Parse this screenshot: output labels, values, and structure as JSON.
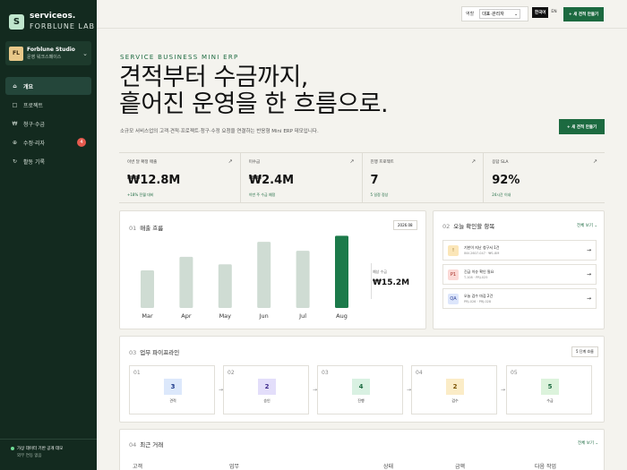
{
  "sidebar": {
    "brand_logo": "S",
    "brand_name": "serviceos.",
    "brand_sub": "FORBLUNE LAB",
    "workspace": {
      "initials": "FL",
      "name": "Forblune Studio",
      "sub": "운영 워크스페이스"
    },
    "items": [
      {
        "icon": "⌂",
        "label": "개요",
        "active": true
      },
      {
        "icon": "□",
        "label": "프로젝트",
        "active": false
      },
      {
        "icon": "₩",
        "label": "청구·수금",
        "active": false
      },
      {
        "icon": "⊕",
        "label": "수정·리자",
        "active": false,
        "badge": "4"
      },
      {
        "icon": "↻",
        "label": "활동 기록",
        "active": false
      }
    ],
    "footer_status": "가상 데이터 기반 공개 데모",
    "footer_sub": "외부 연동 없음"
  },
  "topbar": {
    "role_label": "역할",
    "role_value": "대표·관리자",
    "lang_ko": "한국어",
    "lang_en": "EN",
    "new_button": "+ 새 견적 만들기"
  },
  "hero": {
    "eyebrow": "SERVICE BUSINESS MINI ERP",
    "title_line1": "견적부터 수금까지,",
    "title_line2": "흩어진 운영을 한 흐름으로.",
    "description": "소규모 서비스업의 고객·견적·프로젝트·청구·수정 요청을 연결하는 반응형 Mini ERP 데모입니다.",
    "new_button": "+ 새 견적 만들기"
  },
  "kpis": [
    {
      "label": "이번 달 확정 매출",
      "value": "₩12.8M",
      "note": "+18% 전월 대비"
    },
    {
      "label": "미수금",
      "value": "₩2.4M",
      "note": "이번 주 수금 예정"
    },
    {
      "label": "진행 프로젝트",
      "value": "7",
      "note": "5 일정 정상"
    },
    {
      "label": "응답 SLA",
      "value": "92%",
      "note": "24시간 이내"
    }
  ],
  "revenue_card": {
    "num": "01",
    "title": "매출 흐름",
    "period_chip": "2026.08",
    "metric_label": "예상 수금",
    "metric_value": "₩15.2M"
  },
  "chart_data": {
    "type": "bar",
    "title": "매출 흐름",
    "categories": [
      "Mar",
      "Apr",
      "May",
      "Jun",
      "Jul",
      "Aug"
    ],
    "values": [
      0.5,
      0.68,
      0.58,
      0.88,
      0.76,
      0.96
    ],
    "highlight_index": 5,
    "ylim": [
      0,
      1
    ],
    "grid": false,
    "colors": {
      "bar": "#cfdcd3",
      "highlight": "#1c7a4a"
    }
  },
  "todo_card": {
    "num": "02",
    "title": "오늘 확인할 항목",
    "view_all": "전체 보기 ⌄",
    "items": [
      {
        "badge": "!",
        "title": "기한이 지난 청구서 1건",
        "meta": "INV-2607-047 · ₩1.8M",
        "bg": "#fbe6b8",
        "fg": "#7a5200"
      },
      {
        "badge": "P1",
        "title": "긴급 이슈 확인 필요",
        "meta": "T-108 · PRJ-025",
        "bg": "#fbd9d6",
        "fg": "#a32a22"
      },
      {
        "badge": "QA",
        "title": "오늘 검수 마감 2건",
        "meta": "PRJ-026 · PRJ-028",
        "bg": "#dde6fb",
        "fg": "#2a3f9a"
      }
    ]
  },
  "pipeline_card": {
    "num": "03",
    "title": "업무 파이프라인",
    "chip": "5 단계 흐름",
    "stages": [
      {
        "num": "01",
        "count": "3",
        "label": "견적",
        "bg": "#dce8fb",
        "fg": "#1e3a8a"
      },
      {
        "num": "02",
        "count": "2",
        "label": "승인",
        "bg": "#e3defa",
        "fg": "#3d2a8a"
      },
      {
        "num": "03",
        "count": "4",
        "label": "진행",
        "bg": "#d9f1e2",
        "fg": "#1c6a40"
      },
      {
        "num": "04",
        "count": "2",
        "label": "검수",
        "bg": "#fbecc7",
        "fg": "#7a5200"
      },
      {
        "num": "05",
        "count": "5",
        "label": "수금",
        "bg": "#dcf3dc",
        "fg": "#1c6a40"
      }
    ]
  },
  "deals_card": {
    "num": "04",
    "title": "최근 거래",
    "view_all": "전체 보기 ⌄",
    "columns": [
      "고객",
      "업무",
      "상태",
      "금액",
      "다음 작업"
    ]
  }
}
